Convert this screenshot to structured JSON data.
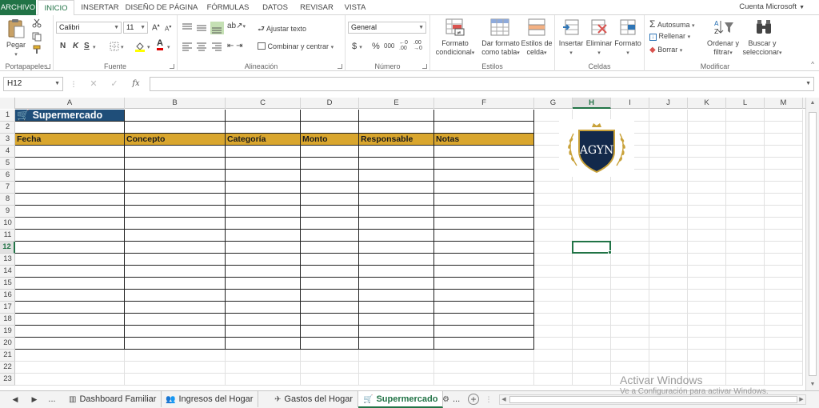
{
  "ribbon": {
    "tabs": [
      "ARCHIVO",
      "INICIO",
      "INSERTAR",
      "DISEÑO DE PÁGINA",
      "FÓRMULAS",
      "DATOS",
      "REVISAR",
      "VISTA"
    ],
    "active_tab": "INICIO",
    "account": "Cuenta Microsoft",
    "clipboard": {
      "paste": "Pegar",
      "label": "Portapapeles"
    },
    "font": {
      "name": "Calibri",
      "size": "11",
      "bold": "N",
      "italic": "K",
      "underline": "S",
      "label": "Fuente"
    },
    "alignment": {
      "wrap": "Ajustar texto",
      "merge": "Combinar y centrar",
      "label": "Alineación"
    },
    "number": {
      "format": "General",
      "currency": "$",
      "percent": "%",
      "thousands": "000",
      "label": "Número"
    },
    "styles": {
      "cond_line1": "Formato",
      "cond_line2": "condicional",
      "table_line1": "Dar formato",
      "table_line2": "como tabla",
      "cell_line1": "Estilos de",
      "cell_line2": "celda",
      "label": "Estilos"
    },
    "cells": {
      "insert": "Insertar",
      "delete": "Eliminar",
      "format": "Formato",
      "label": "Celdas"
    },
    "editing": {
      "autosum": "Autosuma",
      "fill": "Rellenar",
      "clear": "Borrar",
      "sort_line1": "Ordenar y",
      "sort_line2": "filtrar",
      "find_line1": "Buscar y",
      "find_line2": "seleccionar",
      "label": "Modificar"
    }
  },
  "formula_bar": {
    "name_box": "H12",
    "fx": "fx",
    "value": ""
  },
  "grid": {
    "columns": [
      "A",
      "B",
      "C",
      "D",
      "E",
      "F",
      "G",
      "H",
      "I",
      "J",
      "K",
      "L",
      "M"
    ],
    "selected_column": "H",
    "rows": [
      "1",
      "2",
      "3",
      "4",
      "5",
      "6",
      "7",
      "8",
      "9",
      "10",
      "11",
      "12",
      "13",
      "14",
      "15",
      "16",
      "17",
      "18",
      "19",
      "20",
      "21",
      "22",
      "23"
    ],
    "selected_row": "12",
    "title": "Supermercado",
    "headers": [
      "Fecha",
      "Concepto",
      "Categoría",
      "Monto",
      "Responsable",
      "Notas"
    ],
    "logo_text": "AGYN"
  },
  "sheets": {
    "more_left": "...",
    "tabs": [
      "Dashboard Familiar",
      "Ingresos del Hogar",
      "Gastos del Hogar",
      "Supermercado",
      "..."
    ],
    "active": "Supermercado"
  },
  "watermark": {
    "line1": "Activar Windows",
    "line2": "Ve a Configuración para activar Windows."
  },
  "colors": {
    "excel_green": "#217346",
    "title_fill": "#1f4e79",
    "header_fill": "#d9a62e"
  }
}
